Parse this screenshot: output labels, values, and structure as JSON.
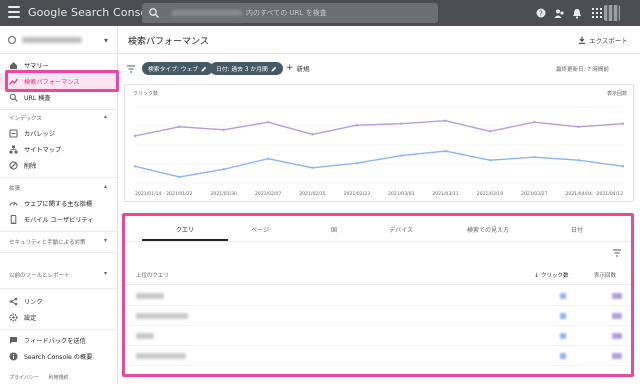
{
  "app": {
    "product_name": "Google Search Console",
    "search_placeholder": "内のすべての URL を検査"
  },
  "sidebar": {
    "items": {
      "summary": "サマリー",
      "performance": "検索パフォーマンス",
      "url_inspection": "URL 検査",
      "coverage": "カバレッジ",
      "sitemaps": "サイトマップ",
      "removals": "削除",
      "web_vitals": "ウェブに関する主な指標",
      "mobile_usability": "モバイル ユーザビリティ",
      "links": "リンク",
      "settings": "設定",
      "feedback": "フィードバックを送信",
      "about": "Search Console の概要"
    },
    "sections": {
      "index": "インデックス",
      "experience": "拡張",
      "security": "セキュリティと手動による対策",
      "legacy": "以前のツールとレポート"
    },
    "footer": {
      "privacy": "プライバシー",
      "terms": "利用規約"
    }
  },
  "main": {
    "title": "検索パフォーマンス",
    "export_label": "エクスポート",
    "filters": {
      "search_type": "検索タイプ: ウェブ",
      "date": "日付: 過去 3 か月間",
      "new_label": "新規",
      "last_updated": "最終更新日: 7 時間前"
    },
    "chart_labels": {
      "left": "クリック数",
      "right": "表示回数"
    },
    "tabs": [
      "クエリ",
      "ページ",
      "国",
      "デバイス",
      "検索での見え方",
      "日付"
    ],
    "table": {
      "col_query": "上位のクエリ",
      "col_clicks": "クリック数",
      "col_impressions": "表示回数"
    }
  },
  "chart_data": {
    "type": "line",
    "x": [
      "2021/01/14",
      "2021/01/22",
      "2021/01/30",
      "2021/02/07",
      "2021/02/15",
      "2021/02/23",
      "2021/03/03",
      "2021/03/11",
      "2021/03/19",
      "2021/03/27",
      "2021/04/04",
      "2021/04/12"
    ],
    "series": [
      {
        "name": "クリック数",
        "color": "#8ab4f8",
        "values": [
          0.22,
          0.08,
          0.18,
          0.32,
          0.2,
          0.26,
          0.36,
          0.42,
          0.3,
          0.34,
          0.3,
          0.22
        ]
      },
      {
        "name": "表示回数",
        "color": "#b39ddb",
        "values": [
          0.62,
          0.74,
          0.7,
          0.8,
          0.64,
          0.76,
          0.78,
          0.82,
          0.68,
          0.8,
          0.74,
          0.78
        ]
      }
    ],
    "grid": true,
    "legend": "none"
  },
  "colors": {
    "accent": "#ec4899",
    "topbar": "#4a4d52",
    "chip": "#455a64",
    "clicks_series": "#8ab4f8",
    "impressions_series": "#b39ddb"
  }
}
